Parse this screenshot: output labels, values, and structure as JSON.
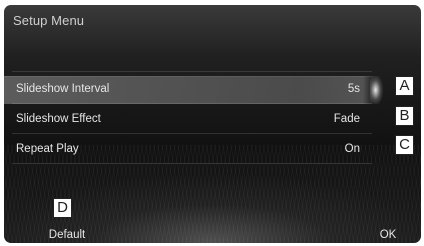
{
  "header": {
    "title": "Setup Menu"
  },
  "settings": [
    {
      "label": "Slideshow Interval",
      "value": "5s",
      "callout": "A",
      "selected": true
    },
    {
      "label": "Slideshow Effect",
      "value": "Fade",
      "callout": "B",
      "selected": false
    },
    {
      "label": "Repeat Play",
      "value": "On",
      "callout": "C",
      "selected": false
    }
  ],
  "footer": {
    "default_label": "Default",
    "default_callout": "D",
    "ok_label": "OK"
  },
  "colors": {
    "screen_background": "#111111",
    "selected_row": "#5f5f5f",
    "text": "#e6e6e6",
    "callout_border": "#222222"
  }
}
